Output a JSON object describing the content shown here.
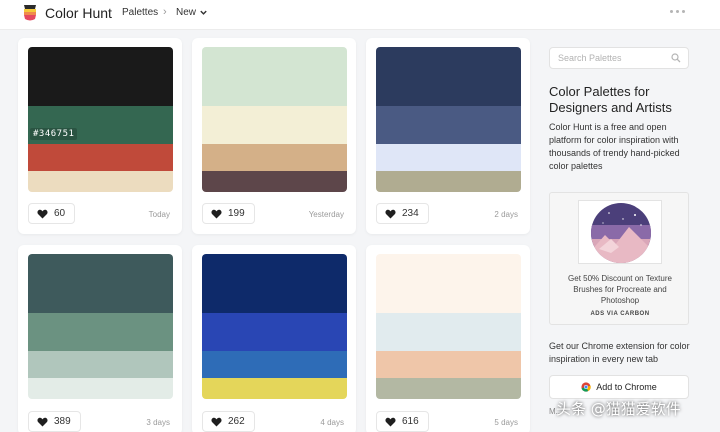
{
  "header": {
    "brand": "Color Hunt",
    "nav_palettes": "Palettes",
    "nav_sep": "›",
    "nav_new": "New"
  },
  "palettes": [
    {
      "colors": [
        "#1a1a1a",
        "#346751",
        "#c04a3a",
        "#ecdcbf"
      ],
      "hover_hex": "#346751",
      "likes": "60",
      "date": "Today"
    },
    {
      "colors": [
        "#d3e5d2",
        "#f3efd6",
        "#d4b088",
        "#5d464a"
      ],
      "likes": "199",
      "date": "Yesterday"
    },
    {
      "colors": [
        "#2c3b5e",
        "#4a5a83",
        "#dfe6f7",
        "#b0ac91"
      ],
      "likes": "234",
      "date": "2 days"
    },
    {
      "colors": [
        "#3e5a5c",
        "#6b9281",
        "#b0c6bc",
        "#e3ece7"
      ],
      "likes": "389",
      "date": "3 days"
    },
    {
      "colors": [
        "#0e2a6a",
        "#2946b4",
        "#2e6cb7",
        "#e4d65a"
      ],
      "likes": "262",
      "date": "4 days"
    },
    {
      "colors": [
        "#fdf4eb",
        "#e1ebee",
        "#efc6a9",
        "#b3b8a3"
      ],
      "likes": "616",
      "date": "5 days"
    }
  ],
  "sidebar": {
    "search_placeholder": "Search Palettes",
    "title": "Color Palettes for Designers and Artists",
    "description": "Color Hunt is a free and open platform for color inspiration with thousands of trendy hand-picked color palettes",
    "ad_text": "Get 50% Discount on Texture Brushes for Procreate and Photoshop",
    "ad_via": "ADS VIA CARBON",
    "chrome_text": "Get our Chrome extension for color inspiration in every new tab",
    "chrome_button": "Add to Chrome",
    "more_link": "M..."
  },
  "watermark": "头条 @猫猫爱软件",
  "colors": {
    "accent": "#346751",
    "heart": "#1f1f1f"
  }
}
